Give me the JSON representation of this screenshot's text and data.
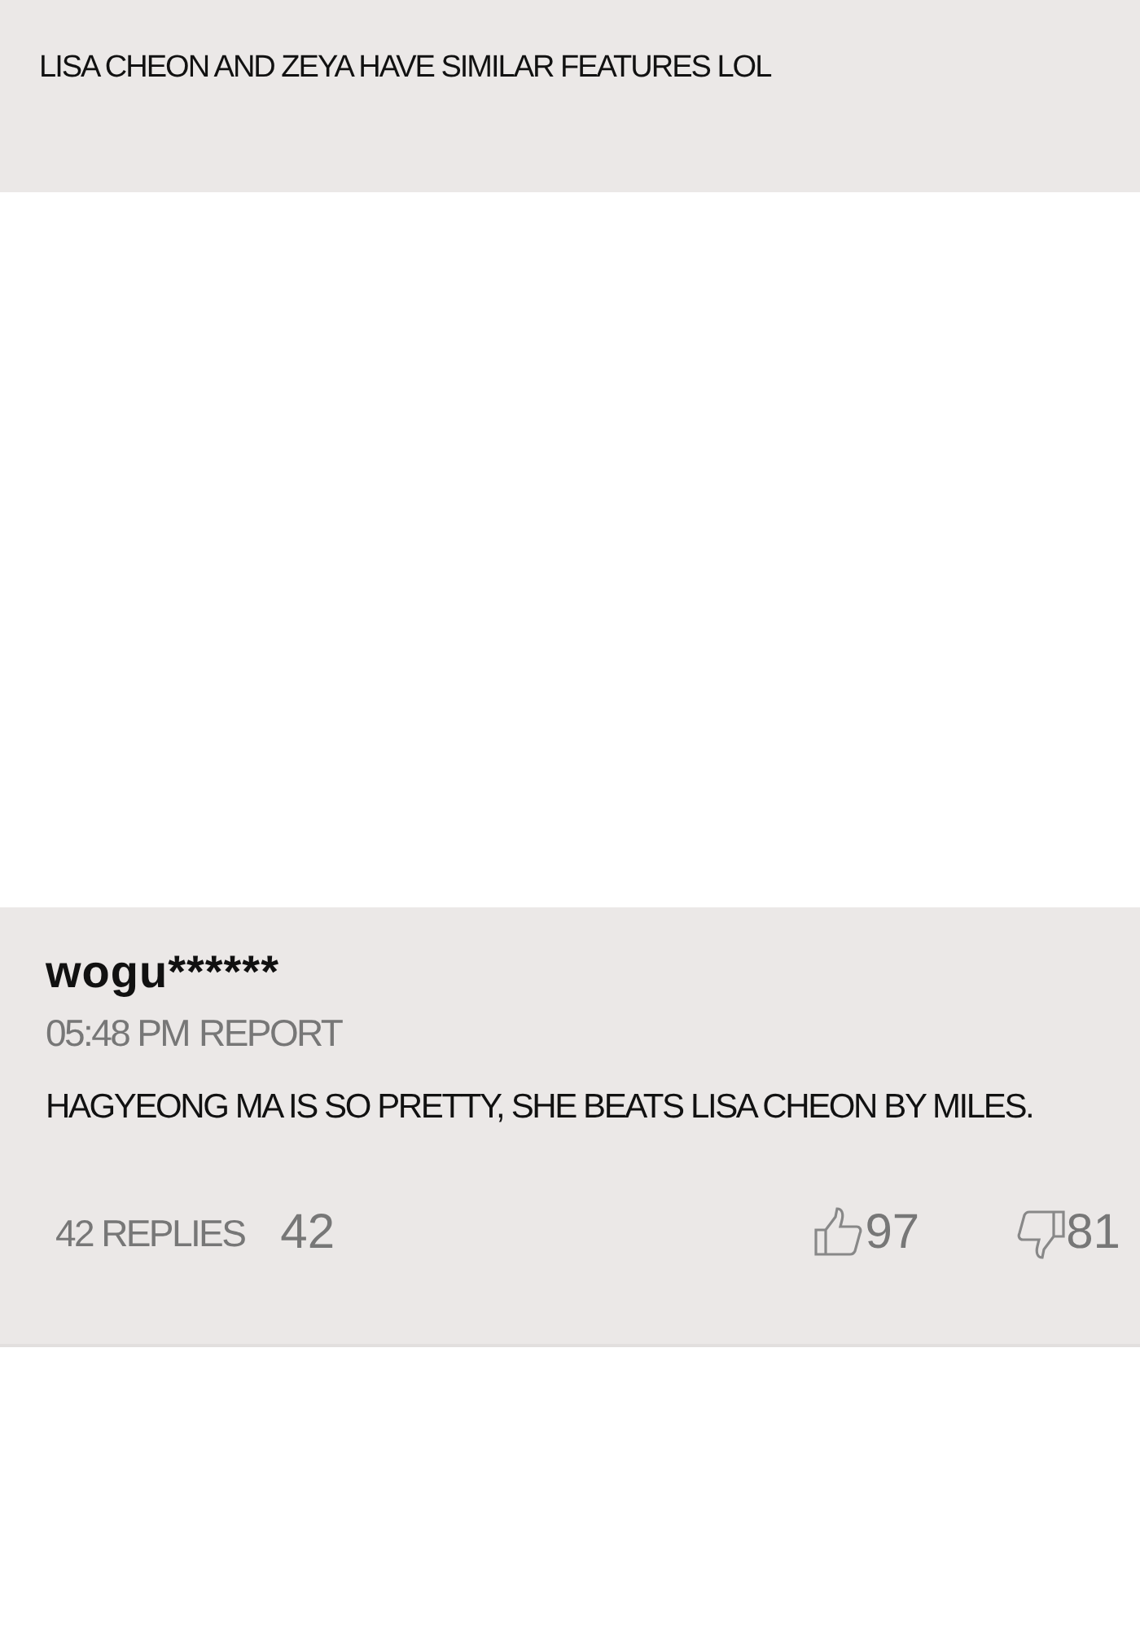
{
  "previous_comment": {
    "text": "LISA CHEON AND ZEYA HAVE SIMILAR FEATURES LOL"
  },
  "comment": {
    "username": "wogu******",
    "time": "05:48 PM",
    "report": "REPORT",
    "text": "HAGYEONG MA IS SO PRETTY, SHE BEATS LISA CHEON BY MILES.",
    "replies_label": "42 REPLIES",
    "replies_count": "42",
    "likes": "97",
    "dislikes": "81"
  }
}
